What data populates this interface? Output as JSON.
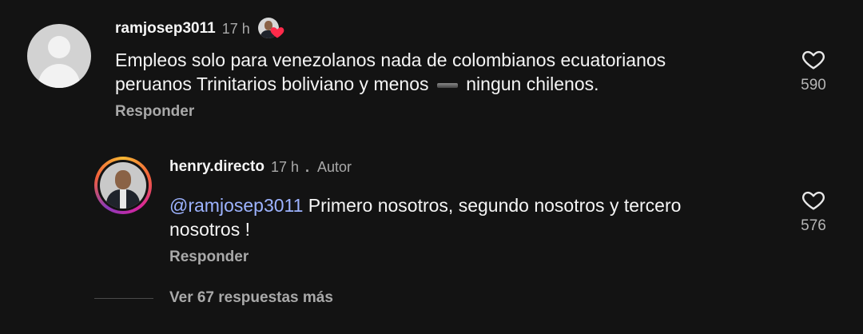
{
  "comments": [
    {
      "username": "ramjosep3011",
      "time": "17 h",
      "text_parts": [
        "Empleos solo para venezolanos nada de colombianos ecuatorianos",
        "peruanos Trinitarios boliviano y menos",
        "ningun chilenos."
      ],
      "reply_label": "Responder",
      "like_count": "590",
      "liked_by_author_indicator": "heart-icon"
    },
    {
      "username": "henry.directo",
      "time": "17 h",
      "separator": ".",
      "author_label": "Autor",
      "mention": "@ramjosep3011",
      "text_line1": " Primero nosotros, segundo nosotros y tercero",
      "text_line2": "nosotros !",
      "reply_label": "Responder",
      "like_count": "576"
    }
  ],
  "view_more_label": "Ver 67 respuestas más",
  "colors": {
    "background": "#131313",
    "text": "#f5f5f5",
    "secondary": "#a9a9a9",
    "mention": "#9db3ff",
    "heart_red": "#ff2a4a"
  }
}
